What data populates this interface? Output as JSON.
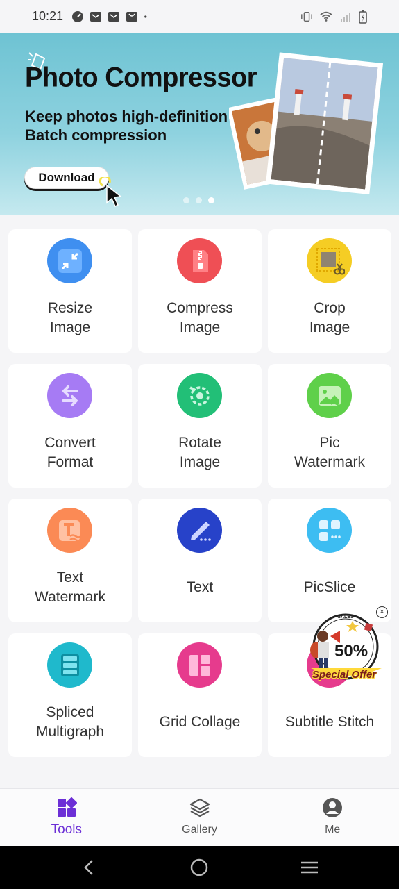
{
  "status_bar": {
    "time": "10:21",
    "left_icons": [
      "speed-icon",
      "mail-icon",
      "mail-icon",
      "bag-icon",
      "dot-icon"
    ],
    "right_icons": [
      "vibrate-icon",
      "wifi-icon",
      "signal-icon",
      "battery-charging-icon"
    ]
  },
  "banner": {
    "title": "Photo Compressor",
    "subtitle_line1": "Keep photos high-definition",
    "subtitle_line2": "Batch compression",
    "button_label": "Download",
    "page_count": 3,
    "active_page": 3
  },
  "tools": [
    {
      "label": "Resize\nImage",
      "icon": "resize-icon",
      "color": "#3f8ff0"
    },
    {
      "label": "Compress\nImage",
      "icon": "zip-file-icon",
      "color": "#ef4f55"
    },
    {
      "label": "Crop\nImage",
      "icon": "crop-scissors-icon",
      "color": "#f5cd24"
    },
    {
      "label": "Convert\nFormat",
      "icon": "convert-arrows-icon",
      "color": "#a67bf4"
    },
    {
      "label": "Rotate\nImage",
      "icon": "rotate-icon",
      "color": "#22bf77"
    },
    {
      "label": "Pic\nWatermark",
      "icon": "picture-watermark-icon",
      "color": "#5fd04a"
    },
    {
      "label": "Text\nWatermark",
      "icon": "text-watermark-icon",
      "color": "#fb8a55"
    },
    {
      "label": "Text",
      "icon": "pencil-icon",
      "color": "#2742c9"
    },
    {
      "label": "PicSlice",
      "icon": "slice-grid-icon",
      "color": "#3dbdf2"
    },
    {
      "label": "Spliced\nMultigraph",
      "icon": "spliced-layers-icon",
      "color": "#1fb9cc"
    },
    {
      "label": "Grid Collage",
      "icon": "grid-collage-icon",
      "color": "#e63b8d"
    },
    {
      "label": "Subtitle Stitch",
      "icon": "subtitle-stitch-icon",
      "color": "#e63b8d"
    }
  ],
  "offer": {
    "percent": "50%",
    "text": "Special Offer",
    "top_text": "SALES",
    "close": "×"
  },
  "bottom_nav": {
    "items": [
      {
        "label": "Tools",
        "icon": "tools-grid-icon",
        "active": true
      },
      {
        "label": "Gallery",
        "icon": "layers-icon",
        "active": false
      },
      {
        "label": "Me",
        "icon": "profile-icon",
        "active": false
      }
    ]
  },
  "colors": {
    "accent": "#6c2fd6",
    "banner_bg": "#7fcbd9",
    "page_bg": "#f5f5f7"
  }
}
